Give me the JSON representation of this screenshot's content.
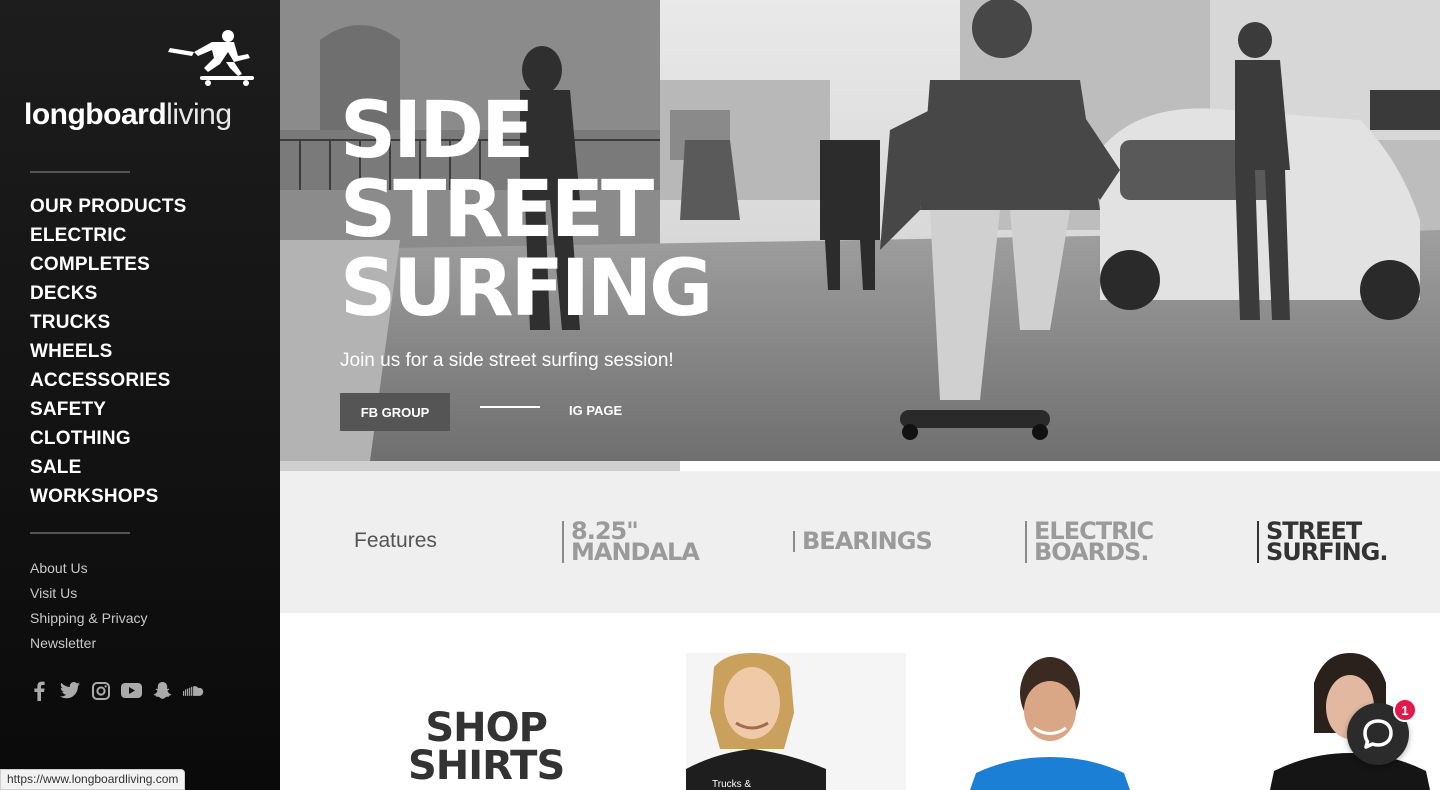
{
  "sidebar": {
    "logo": {
      "bold": "longboard",
      "light": "living"
    },
    "nav": [
      "OUR PRODUCTS",
      "ELECTRIC",
      "COMPLETES",
      "DECKS",
      "TRUCKS",
      "WHEELS",
      "ACCESSORIES",
      "SAFETY",
      "CLOTHING",
      "SALE",
      "WORKSHOPS"
    ],
    "links": [
      "About Us",
      "Visit Us",
      "Shipping & Privacy",
      "Newsletter"
    ],
    "social": [
      "facebook-icon",
      "twitter-icon",
      "instagram-icon",
      "youtube-icon",
      "snapchat-icon",
      "soundcloud-icon"
    ]
  },
  "hero": {
    "title": [
      "SIDE",
      "STREET",
      "SURFING"
    ],
    "subtitle": "Join us for a side street surfing session!",
    "fb_button": "FB GROUP",
    "ig_button": "IG PAGE",
    "slide_progress": 0.345
  },
  "features": {
    "label": "Features",
    "items": [
      {
        "line1": "8.25\"",
        "line2": "MANDALA",
        "active": false
      },
      {
        "line1": "BEARINGS",
        "line2": "",
        "active": false
      },
      {
        "line1": "ELECTRIC",
        "line2": "BOARDS.",
        "active": false
      },
      {
        "line1": "STREET",
        "line2": "SURFING.",
        "active": true
      }
    ]
  },
  "shop": {
    "title_line1": "SHOP",
    "title_line2": "SHIRTS",
    "shirt_text": "Trucks &"
  },
  "chat": {
    "badge": "1"
  },
  "status_bar": {
    "url": "https://www.longboardliving.com"
  },
  "colors": {
    "sidebar_bg": "#111111",
    "badge": "#e3194b",
    "shirt_blue": "#1c7fd6"
  }
}
